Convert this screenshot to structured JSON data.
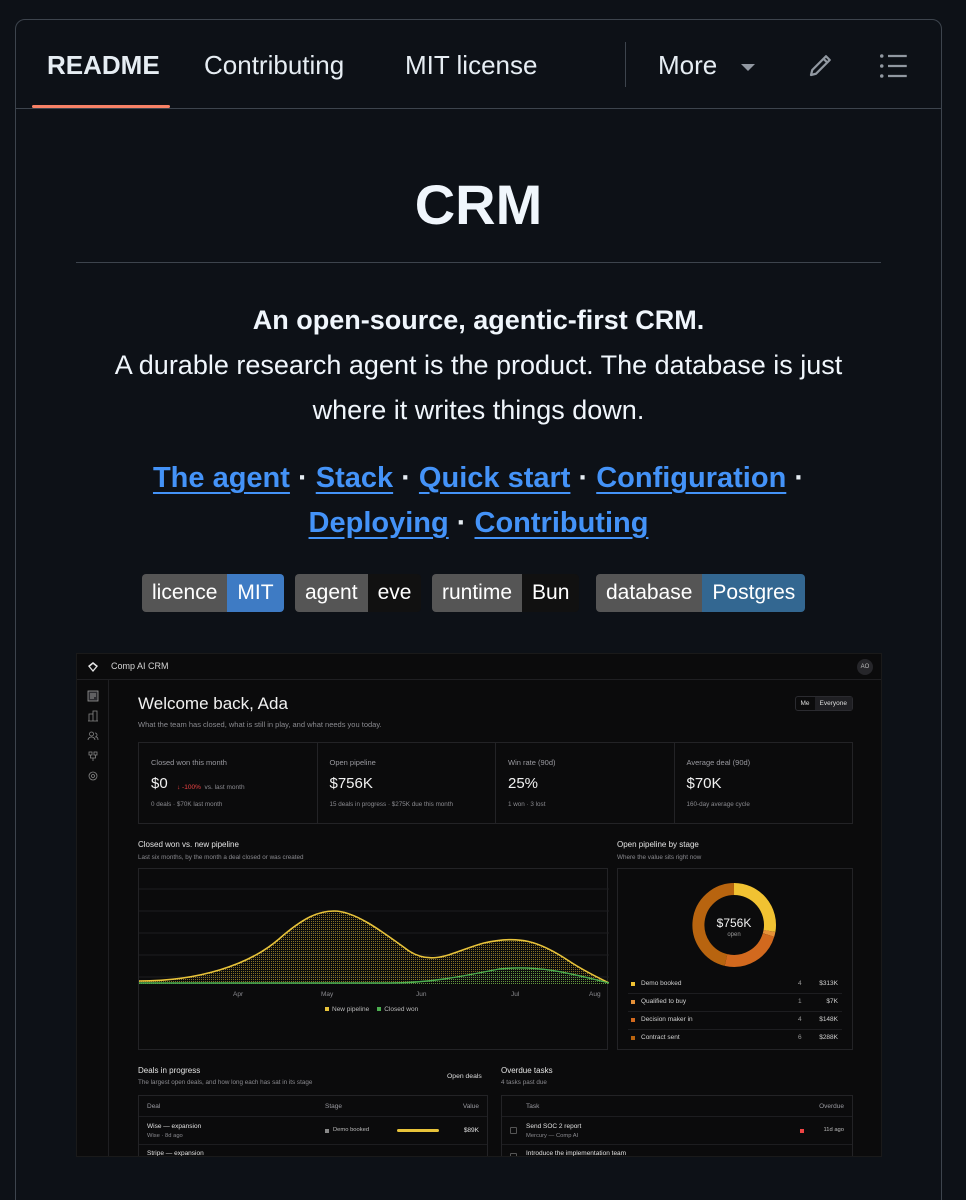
{
  "tabs": {
    "items": [
      "README",
      "Contributing",
      "MIT license"
    ],
    "more_label": "More"
  },
  "readme": {
    "title": "CRM",
    "tagline_bold": "An open-source, agentic-first CRM.",
    "tagline_rest": "A durable research agent is the product. The database is just where it writes things down.",
    "links": [
      "The agent",
      "Stack",
      "Quick start",
      "Configuration",
      "Deploying",
      "Contributing"
    ],
    "link_separator": "·",
    "badges": [
      {
        "key": "licence",
        "value": "MIT",
        "color": "#3e7bc4"
      },
      {
        "key": "agent",
        "value": "eve",
        "color": "#111111"
      },
      {
        "key": "runtime",
        "value": "Bun",
        "color": "#111111"
      },
      {
        "key": "database",
        "value": "Postgres",
        "color": "#336791"
      }
    ]
  },
  "screenshot": {
    "app_title": "Comp AI CRM",
    "avatar": "AO",
    "welcome": "Welcome back, Ada",
    "welcome_sub": "What the team has closed, what is still in play, and what needs you today.",
    "toggle": [
      "Me",
      "Everyone"
    ],
    "kpis": [
      {
        "label": "Closed won this month",
        "value": "$0",
        "delta": "↓ -100%",
        "delta_tail": "vs. last month",
        "sub": "0 deals · $70K last month"
      },
      {
        "label": "Open pipeline",
        "value": "$756K",
        "sub": "15 deals in progress · $275K due this month"
      },
      {
        "label": "Win rate (90d)",
        "value": "25%",
        "sub": "1 won · 3 lost"
      },
      {
        "label": "Average deal (90d)",
        "value": "$70K",
        "sub": "160-day average cycle"
      }
    ],
    "pipeline_chart": {
      "title": "Closed won vs. new pipeline",
      "subtitle": "Last six months, by the month a deal closed or was created",
      "legend": [
        "New pipeline",
        "Closed won"
      ]
    },
    "stage_chart": {
      "title": "Open pipeline by stage",
      "subtitle": "Where the value sits right now",
      "center_value": "$756K",
      "center_label": "open",
      "stages": [
        {
          "name": "Demo booked",
          "count": "4",
          "amount": "$313K",
          "color": "#f1c232"
        },
        {
          "name": "Qualified to buy",
          "count": "1",
          "amount": "$7K",
          "color": "#e69138"
        },
        {
          "name": "Decision maker in",
          "count": "4",
          "amount": "$148K",
          "color": "#d2691e"
        },
        {
          "name": "Contract sent",
          "count": "6",
          "amount": "$288K",
          "color": "#b45309"
        }
      ]
    },
    "deals": {
      "title": "Deals in progress",
      "subtitle": "The largest open deals, and how long each has sat in its stage",
      "open_link": "Open deals",
      "columns": [
        "Deal",
        "Stage",
        "Value"
      ],
      "rows": [
        {
          "name": "Wise — expansion",
          "sub": "Wise · 8d ago",
          "stage": "Demo booked",
          "value": "$89K"
        },
        {
          "name": "Stripe — expansion",
          "sub": "",
          "stage": "",
          "value": ""
        }
      ]
    },
    "tasks": {
      "title": "Overdue tasks",
      "subtitle": "4 tasks past due",
      "columns": [
        "Task",
        "Overdue"
      ],
      "rows": [
        {
          "name": "Send SOC 2 report",
          "sub": "Mercury — Comp AI",
          "overdue": "11d ago"
        },
        {
          "name": "Introduce the implementation team",
          "sub": "",
          "overdue": ""
        }
      ]
    }
  },
  "chart_data": {
    "type": "area",
    "title": "Closed won vs. new pipeline",
    "x": [
      "Apr",
      "May",
      "Jun",
      "Jul",
      "Aug"
    ],
    "series": [
      {
        "name": "New pipeline",
        "color": "#e8c33a"
      },
      {
        "name": "Closed won",
        "color": "#4caf50"
      }
    ]
  }
}
